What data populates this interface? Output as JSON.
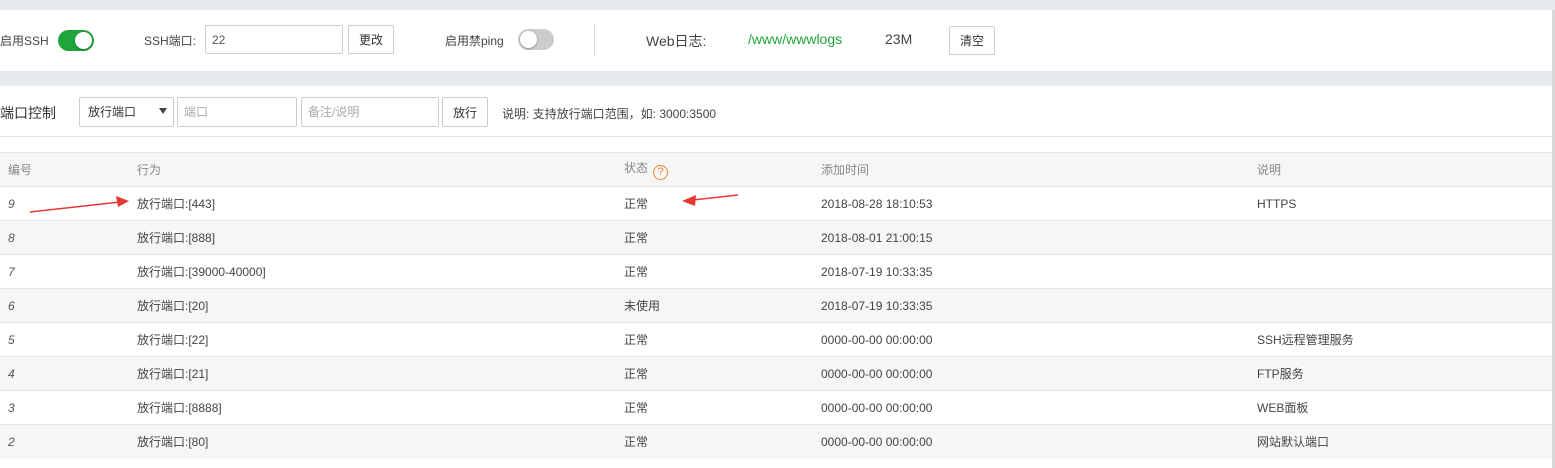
{
  "ssh": {
    "enable_label": "启用SSH",
    "enabled": true,
    "port_label": "SSH端口:",
    "port_value": "22",
    "change_button": "更改",
    "ping_label": "启用禁ping",
    "ping_enabled": false
  },
  "weblog": {
    "label": "Web日志:",
    "path": "/www/wwwlogs",
    "size": "23M",
    "clear_button": "清空"
  },
  "port_control": {
    "title": "端口控制",
    "action_select": "放行端口",
    "port_placeholder": "端口",
    "note_placeholder": "备注/说明",
    "submit_button": "放行",
    "hint": "说明: 支持放行端口范围，如: 3000:3500"
  },
  "table": {
    "headers": {
      "id": "编号",
      "action": "行为",
      "status": "状态",
      "status_help": "?",
      "time": "添加时间",
      "note": "说明"
    },
    "rows": [
      {
        "id": "9",
        "action": "放行端口:[443]",
        "status": "正常",
        "time": "2018-08-28 18:10:53",
        "note": "HTTPS"
      },
      {
        "id": "8",
        "action": "放行端口:[888]",
        "status": "正常",
        "time": "2018-08-01 21:00:15",
        "note": ""
      },
      {
        "id": "7",
        "action": "放行端口:[39000-40000]",
        "status": "正常",
        "time": "2018-07-19 10:33:35",
        "note": ""
      },
      {
        "id": "6",
        "action": "放行端口:[20]",
        "status": "未使用",
        "time": "2018-07-19 10:33:35",
        "note": ""
      },
      {
        "id": "5",
        "action": "放行端口:[22]",
        "status": "正常",
        "time": "0000-00-00 00:00:00",
        "note": "SSH远程管理服务"
      },
      {
        "id": "4",
        "action": "放行端口:[21]",
        "status": "正常",
        "time": "0000-00-00 00:00:00",
        "note": "FTP服务"
      },
      {
        "id": "3",
        "action": "放行端口:[8888]",
        "status": "正常",
        "time": "0000-00-00 00:00:00",
        "note": "WEB面板"
      },
      {
        "id": "2",
        "action": "放行端口:[80]",
        "status": "正常",
        "time": "0000-00-00 00:00:00",
        "note": "网站默认端口"
      }
    ]
  },
  "colors": {
    "accent_green": "#20a53a",
    "annotation_red": "#e53935",
    "help_orange": "#f0842b"
  }
}
